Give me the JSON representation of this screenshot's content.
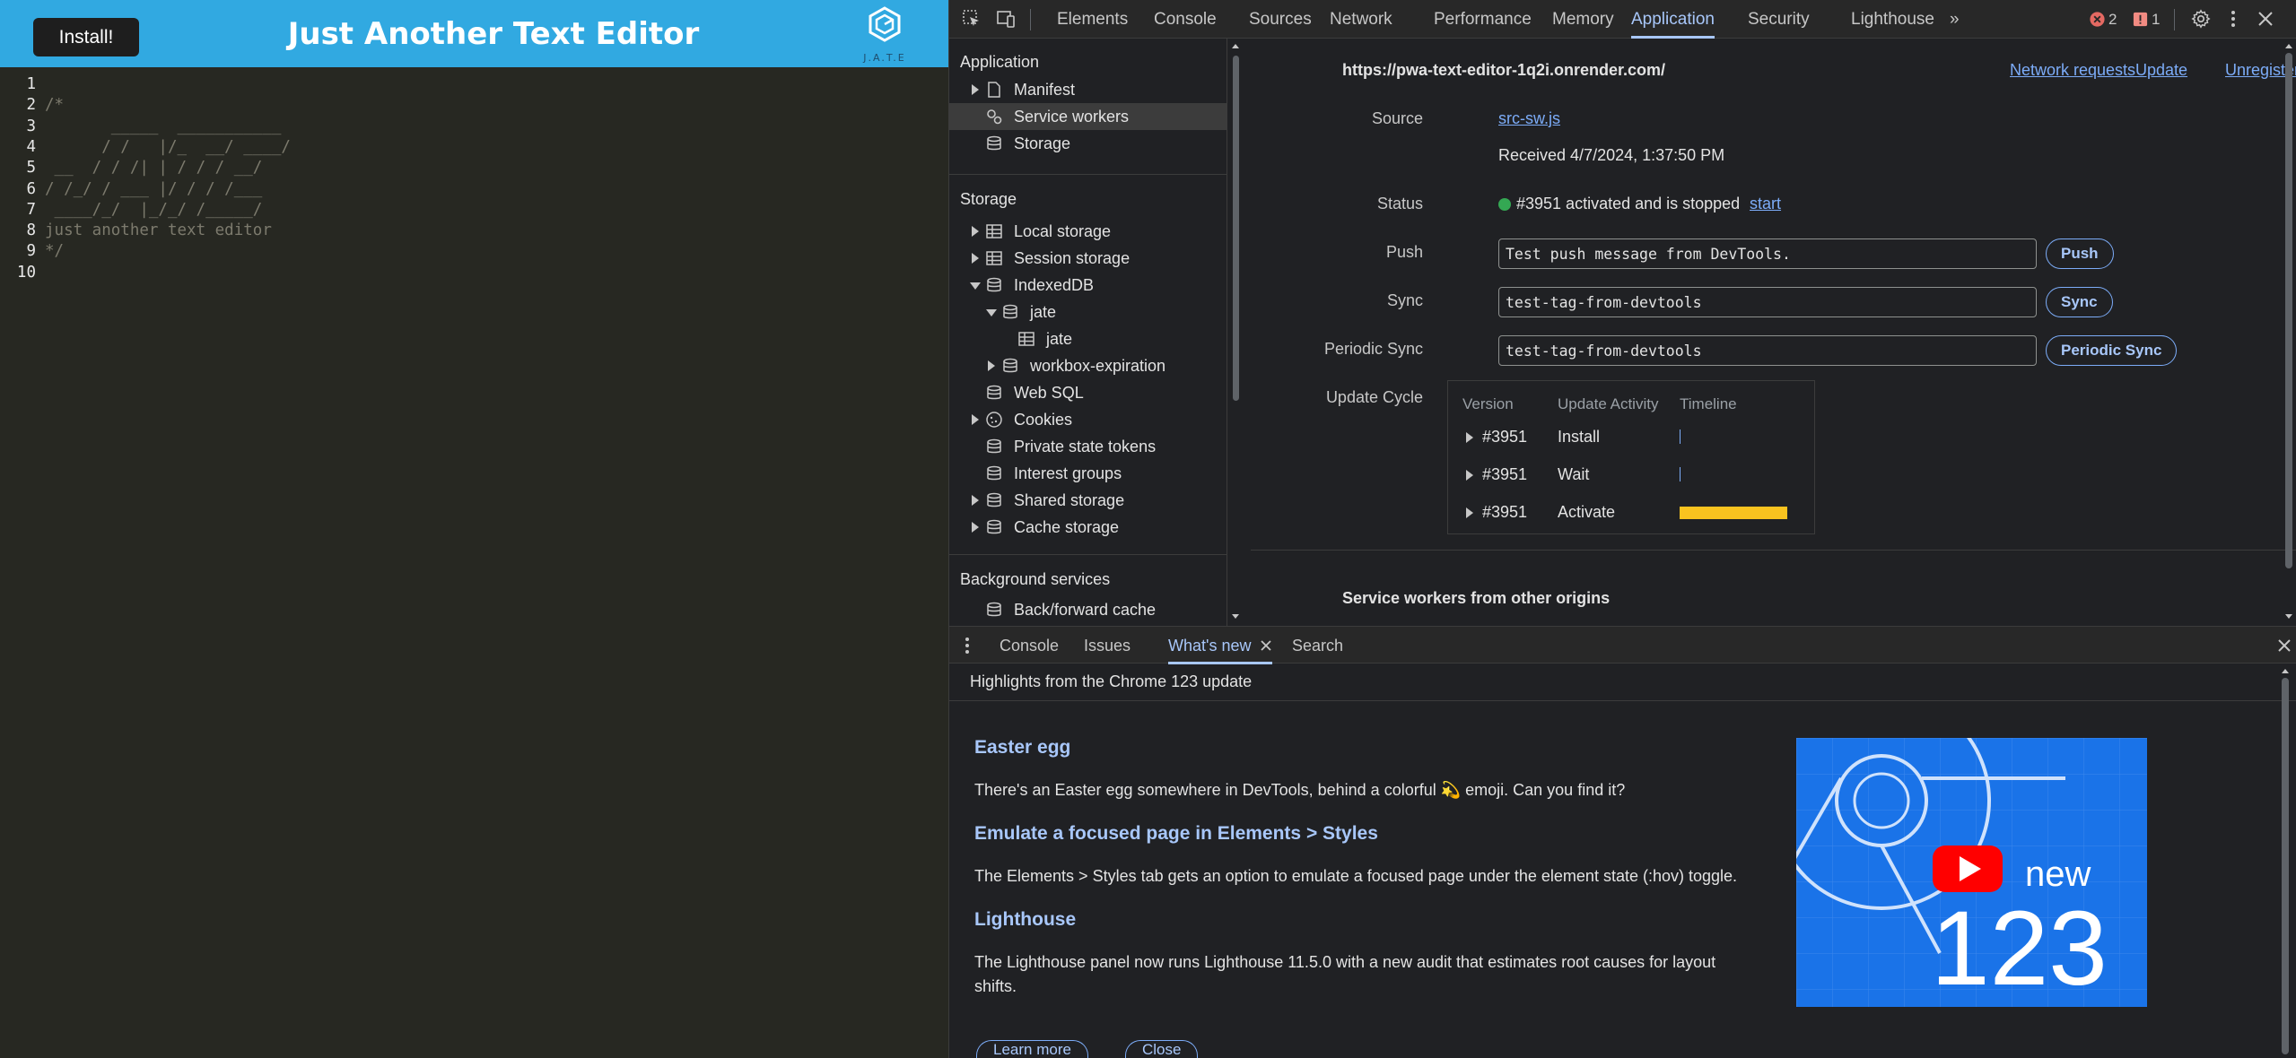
{
  "app": {
    "install_label": "Install!",
    "title": "Just Another Text Editor",
    "logo_text": "J.A.T.E",
    "editor_lines": [
      {
        "n": "1",
        "text": ""
      },
      {
        "n": "2",
        "text": "/*"
      },
      {
        "n": "3",
        "text": "       _____  ___________"
      },
      {
        "n": "4",
        "text": "      / /   |/_  __/ ____/"
      },
      {
        "n": "5",
        "text": " __  / / /| | / / / __/"
      },
      {
        "n": "6",
        "text": "/ /_/ / ___ |/ / / /___"
      },
      {
        "n": "7",
        "text": " ____/_/  |_/_/ /_____/"
      },
      {
        "n": "8",
        "text": "just another text editor"
      },
      {
        "n": "9",
        "text": "*/"
      },
      {
        "n": "10",
        "text": ""
      }
    ]
  },
  "devtools": {
    "tabs": [
      "Elements",
      "Console",
      "Sources",
      "Network",
      "Performance",
      "Memory",
      "Application",
      "Security",
      "Lighthouse"
    ],
    "active_tab": "Application",
    "more_tabs": "»",
    "error_count": "2",
    "warning_count": "1",
    "sidebar": {
      "application_header": "Application",
      "application_items": [
        "Manifest",
        "Service workers",
        "Storage"
      ],
      "storage_header": "Storage",
      "storage_items": {
        "local_storage": "Local storage",
        "session_storage": "Session storage",
        "indexeddb": "IndexedDB",
        "db_jate": "jate",
        "store_jate": "jate",
        "workbox": "workbox-expiration",
        "web_sql": "Web SQL",
        "cookies": "Cookies",
        "private_state_tokens": "Private state tokens",
        "interest_groups": "Interest groups",
        "shared_storage": "Shared storage",
        "cache_storage": "Cache storage"
      },
      "background_header": "Background services",
      "background_items": [
        "Back/forward cache"
      ]
    },
    "service_worker": {
      "origin": "https://pwa-text-editor-1q2i.onrender.com/",
      "network_requests": "Network requests",
      "update": "Update",
      "unregister": "Unregister",
      "source_label": "Source",
      "source_file": "src-sw.js",
      "received": "Received 4/7/2024, 1:37:50 PM",
      "status_label": "Status",
      "status_text": "#3951 activated and is stopped",
      "start": "start",
      "status_color": "#34a853",
      "push_label": "Push",
      "push_value": "Test push message from DevTools.",
      "push_btn": "Push",
      "sync_label": "Sync",
      "sync_value": "test-tag-from-devtools",
      "sync_btn": "Sync",
      "periodic_label": "Periodic Sync",
      "periodic_value": "test-tag-from-devtools",
      "periodic_btn": "Periodic Sync",
      "update_cycle_label": "Update Cycle",
      "uc_headers": [
        "Version",
        "Update Activity",
        "Timeline"
      ],
      "uc_rows": [
        {
          "version": "#3951",
          "activity": "Install"
        },
        {
          "version": "#3951",
          "activity": "Wait"
        },
        {
          "version": "#3951",
          "activity": "Activate"
        }
      ],
      "timeline_color": "#f9c31f",
      "other_origins": "Service workers from other origins"
    },
    "drawer": {
      "tabs": [
        "Console",
        "Issues",
        "What's new",
        "Search"
      ],
      "active_tab": "What's new",
      "subhead": "Highlights from the Chrome 123 update",
      "items": [
        {
          "title": "Easter egg",
          "body": "There's an Easter egg somewhere in DevTools, behind a colorful 💫 emoji. Can you find it?"
        },
        {
          "title": "Emulate a focused page in Elements > Styles",
          "body": "The Elements > Styles tab gets an option to emulate a focused page under the element state (:hov) toggle."
        },
        {
          "title": "Lighthouse",
          "body": "The Lighthouse panel now runs Lighthouse 11.5.0 with a new audit that estimates root causes for layout shifts."
        }
      ],
      "image_new": "new",
      "image_version": "123",
      "learn_more": "Learn more",
      "close": "Close"
    }
  }
}
